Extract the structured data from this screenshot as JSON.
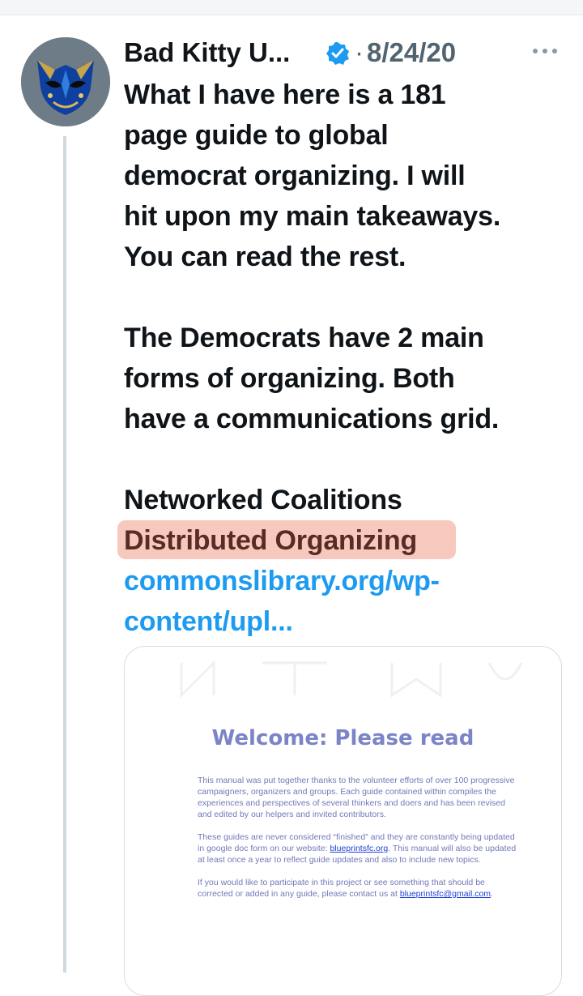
{
  "tweet": {
    "author_name": "Bad Kitty U...",
    "dot": "·",
    "date": "8/24/20",
    "paragraphs": [
      [
        "What I have here is a 181",
        "page guide to global",
        "democrat organizing. I will",
        "hit upon my main takeaways.",
        "You can read the rest."
      ],
      [
        "The Democrats have 2 main",
        "forms of organizing. Both",
        "have a communications grid."
      ]
    ],
    "list_item_1": "Networked Coalitions",
    "list_item_2": "Distributed Organizing",
    "link_line_1": "commonslibrary.org/wp-",
    "link_line_2": "content/upl..."
  },
  "card": {
    "title": "Welcome: Please read",
    "p1": "This manual was put together thanks to the volunteer efforts of over 100 progressive campaigners, organizers and groups. Each guide contained within compiles the experiences and perspectives of several thinkers and doers and has been revised and edited by our helpers and invited contributors.",
    "p2_before": "These guides are never considered “finished” and they are constantly being updated in google doc form on our website: ",
    "p2_link": "blueprintsfc.org",
    "p2_after": ". This manual will also be updated at least once a year to reflect guide updates and also to include new topics.",
    "p3_before": "If you would like to participate in this project or see something that should be corrected or added in any guide, please contact us at ",
    "p3_link": "blueprintsfc@gmail.com",
    "p3_after": "."
  },
  "colors": {
    "link": "#1d9bf0",
    "verified": "#1d9bf0",
    "highlight": "#f6c3b7",
    "card_title": "#7a84c7"
  },
  "icons": [
    "avatar-cat-mask",
    "verified-badge-icon",
    "more-options-icon"
  ]
}
